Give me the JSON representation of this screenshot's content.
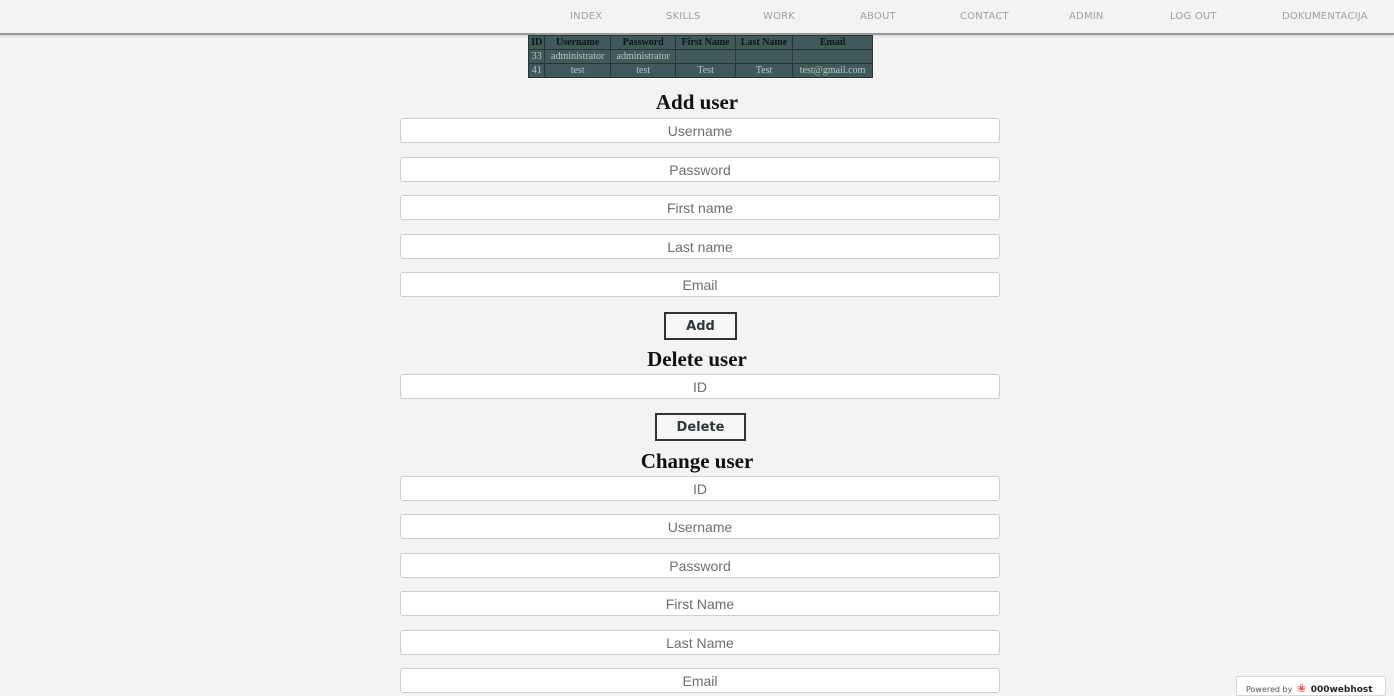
{
  "nav": {
    "items": [
      "INDEX",
      "SKILLS",
      "WORK",
      "ABOUT",
      "CONTACT",
      "ADMIN",
      "LOG OUT",
      "DOKUMENTACIJA"
    ]
  },
  "users_table": {
    "headers": [
      "ID",
      "Username",
      "Password",
      "First Name",
      "Last Name",
      "Email"
    ],
    "rows": [
      [
        "33",
        "administrator",
        "administrator",
        "",
        "",
        ""
      ],
      [
        "41",
        "test",
        "test",
        "Test",
        "Test",
        "test@gmail.com"
      ]
    ]
  },
  "add_user": {
    "title": "Add user",
    "username_placeholder": "Username",
    "password_placeholder": "Password",
    "first_name_placeholder": "First name",
    "last_name_placeholder": "Last name",
    "email_placeholder": "Email",
    "button_label": "Add"
  },
  "delete_user": {
    "title": "Delete user",
    "id_placeholder": "ID",
    "button_label": "Delete"
  },
  "change_user": {
    "title": "Change user",
    "id_placeholder": "ID",
    "username_placeholder": "Username",
    "password_placeholder": "Password",
    "first_name_placeholder": "First Name",
    "last_name_placeholder": "Last Name",
    "email_placeholder": "Email"
  },
  "footer": {
    "powered_prefix": "Powered by",
    "powered_brand": "000webhost",
    "logo_icon": "webhost-logo-icon"
  },
  "colors": {
    "table_bg": "#3f5a58",
    "page_bg": "#f3f3f3"
  }
}
